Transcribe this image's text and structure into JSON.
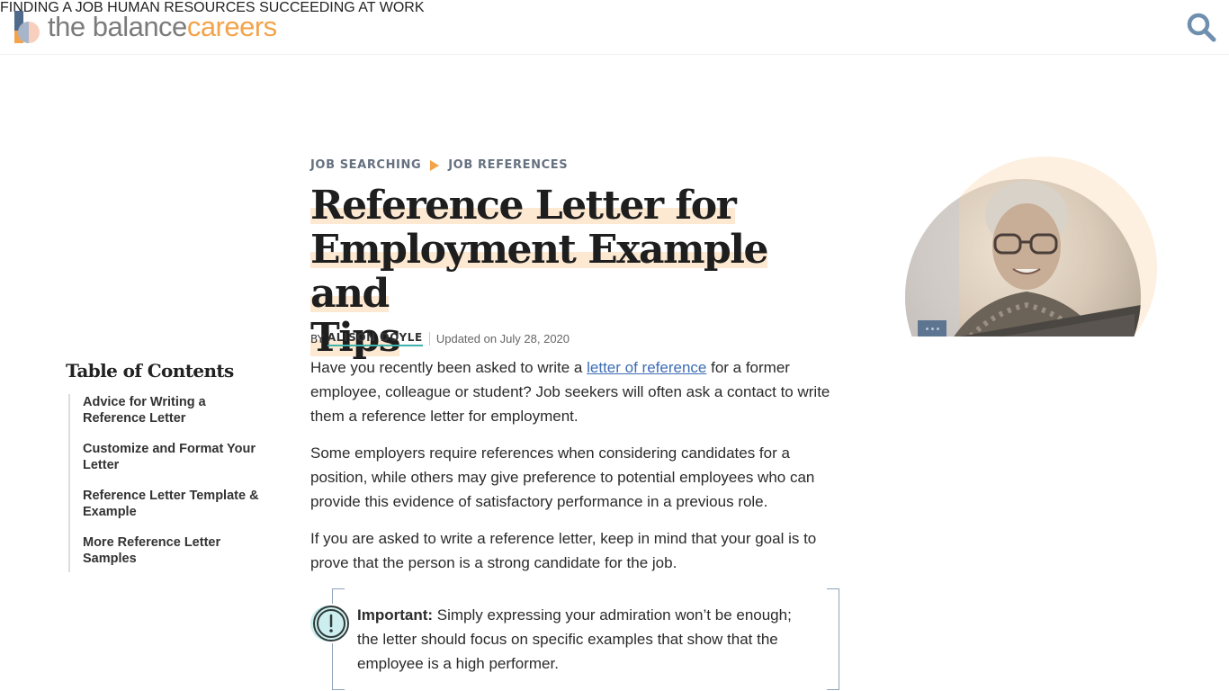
{
  "header": {
    "logo": {
      "text_primary": "the balance",
      "text_accent": "careers"
    },
    "nav": [
      {
        "label": "FINDING A JOB"
      },
      {
        "label": "HUMAN RESOURCES"
      },
      {
        "label": "SUCCEEDING AT WORK"
      }
    ],
    "search_icon": "search-icon"
  },
  "breadcrumb": {
    "items": [
      {
        "label": "JOB SEARCHING"
      },
      {
        "label": "JOB REFERENCES"
      }
    ],
    "separator_icon": "triangle-right-icon"
  },
  "article": {
    "title": "Reference Letter for Employment Example and Tips",
    "title_lines": [
      "Reference Letter for",
      "Employment Example and",
      "Tips"
    ],
    "byline": {
      "prefix": "BY",
      "author": "ALISON DOYLE",
      "updated": "Updated on July 28, 2020"
    },
    "paragraphs": [
      {
        "before_link": "Have you recently been asked to write a ",
        "link_text": "letter of reference",
        "after_link": " for a former employee, colleague or student? Job seekers will often ask a contact to write them a reference letter for employment."
      },
      {
        "text": "Some employers require references when considering candidates for a position, while others may give preference to potential employees who can provide this evidence of satisfactory performance in a previous role."
      },
      {
        "text": "If you are asked to write a reference letter, keep in mind that your goal is to prove that the person is a strong candidate for the job."
      }
    ],
    "callout": {
      "icon": "exclamation-circle-icon",
      "label": "Important:",
      "text": " Simply expressing your admiration won’t be enough; the letter should focus on specific examples that show that the employee is a high performer."
    }
  },
  "toc": {
    "heading": "Table of Contents",
    "items": [
      {
        "label": "Advice for Writing a Reference Letter"
      },
      {
        "label": "Customize and Format Your Letter"
      },
      {
        "label": "Reference Letter Template & Example"
      },
      {
        "label": "More Reference Letter Samples"
      }
    ]
  },
  "hero": {
    "image_alt": "Woman with glasses smiling at computer monitor",
    "badge_icon": "more-dots-icon"
  },
  "colors": {
    "accent_orange": "#f3a34a",
    "logo_blue": "#4f6a8a",
    "link_blue": "#3d6db5",
    "title_highlight": "#fde8d1",
    "author_underline": "#3fb3ad",
    "callout_border": "#8ea3ba",
    "search_icon": "#6f8fae"
  }
}
